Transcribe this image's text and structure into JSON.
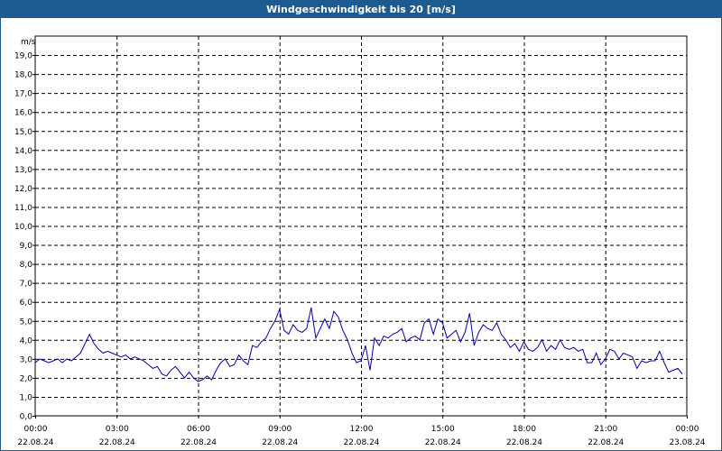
{
  "window": {
    "title": "Windgeschwindigkeit bis 20 [m/s]"
  },
  "colors": {
    "title_bar": "#1c5a8f",
    "series": "#0000a0",
    "grid": "#000000"
  },
  "chart_data": {
    "type": "line",
    "title": "Windgeschwindigkeit bis 20 [m/s]",
    "ylabel": "m/s",
    "ylim": [
      0,
      20
    ],
    "yticks": [
      "0,0",
      "1,0",
      "2,0",
      "3,0",
      "4,0",
      "5,0",
      "6,0",
      "7,0",
      "8,0",
      "9,0",
      "10,0",
      "11,0",
      "12,0",
      "13,0",
      "14,0",
      "15,0",
      "16,0",
      "17,0",
      "18,0",
      "19,0"
    ],
    "xlim": [
      "22.08.24 00:00",
      "23.08.24 00:00"
    ],
    "xticks": [
      {
        "time": "00:00",
        "date": "22.08.24"
      },
      {
        "time": "03:00",
        "date": "22.08.24"
      },
      {
        "time": "06:00",
        "date": "22.08.24"
      },
      {
        "time": "09:00",
        "date": "22.08.24"
      },
      {
        "time": "12:00",
        "date": "22.08.24"
      },
      {
        "time": "15:00",
        "date": "22.08.24"
      },
      {
        "time": "18:00",
        "date": "22.08.24"
      },
      {
        "time": "21:00",
        "date": "22.08.24"
      },
      {
        "time": "00:00",
        "date": "23.08.24"
      }
    ],
    "grid": true,
    "grid_style": "dashed",
    "series": [
      {
        "x": [
          "00:00",
          "00:10",
          "00:20",
          "00:30",
          "00:40",
          "00:50",
          "01:00",
          "01:10",
          "01:20",
          "01:30",
          "01:40",
          "01:50",
          "02:00",
          "02:10",
          "02:20",
          "02:30",
          "02:40",
          "02:50",
          "03:00",
          "03:10",
          "03:20",
          "03:30",
          "03:40",
          "03:50",
          "04:00",
          "04:10",
          "04:20",
          "04:30",
          "04:40",
          "04:50",
          "05:00",
          "05:10",
          "05:20",
          "05:30",
          "05:40",
          "05:50",
          "06:00",
          "06:10",
          "06:20",
          "06:30",
          "06:40",
          "06:50",
          "07:00",
          "07:10",
          "07:20",
          "07:30",
          "07:40",
          "07:50",
          "08:00",
          "08:10",
          "08:20",
          "08:30",
          "08:40",
          "08:50",
          "09:00",
          "09:10",
          "09:20",
          "09:30",
          "09:40",
          "09:50",
          "10:00",
          "10:10",
          "10:20",
          "10:30",
          "10:40",
          "10:50",
          "11:00",
          "11:10",
          "11:20",
          "11:30",
          "11:40",
          "11:50",
          "12:00",
          "12:10",
          "12:20",
          "12:30",
          "12:40",
          "12:50",
          "13:00",
          "13:10",
          "13:20",
          "13:30",
          "13:40",
          "13:50",
          "14:00",
          "14:10",
          "14:20",
          "14:30",
          "14:40",
          "14:50",
          "15:00",
          "15:10",
          "15:20",
          "15:30",
          "15:40",
          "15:50",
          "16:00",
          "16:10",
          "16:20",
          "16:30",
          "16:40",
          "16:50",
          "17:00",
          "17:10",
          "17:20",
          "17:30",
          "17:40",
          "17:50",
          "18:00",
          "18:10",
          "18:20",
          "18:30",
          "18:40",
          "18:50",
          "19:00",
          "19:10",
          "19:20",
          "19:30",
          "19:40",
          "19:50",
          "20:00",
          "20:10",
          "20:20",
          "20:30",
          "20:40",
          "20:50",
          "21:00",
          "21:10",
          "21:20",
          "21:30",
          "21:40",
          "21:50",
          "22:00",
          "22:10",
          "22:20",
          "22:30",
          "22:40",
          "22:50",
          "23:00",
          "23:10",
          "23:20",
          "23:30",
          "23:40",
          "23:50"
        ],
        "values": [
          2.8,
          3.0,
          2.9,
          2.8,
          2.9,
          3.0,
          2.8,
          3.0,
          2.9,
          3.1,
          3.3,
          3.8,
          4.3,
          3.8,
          3.5,
          3.3,
          3.4,
          3.3,
          3.2,
          3.1,
          3.2,
          3.0,
          3.1,
          3.0,
          2.9,
          2.7,
          2.5,
          2.6,
          2.2,
          2.1,
          2.4,
          2.6,
          2.3,
          2.0,
          2.3,
          2.0,
          1.8,
          1.9,
          2.1,
          1.9,
          2.4,
          2.8,
          3.0,
          2.6,
          2.7,
          3.2,
          2.9,
          2.7,
          3.7,
          3.6,
          3.9,
          4.1,
          4.6,
          5.0,
          5.6,
          4.5,
          4.3,
          4.8,
          4.5,
          4.4,
          4.6,
          5.7,
          4.1,
          4.6,
          5.1,
          4.6,
          5.5,
          5.2,
          4.5,
          4.0,
          3.3,
          2.8,
          2.9,
          3.7,
          2.4,
          4.1,
          3.7,
          4.2,
          4.1,
          4.3,
          4.4,
          4.6,
          3.9,
          4.1,
          4.2,
          4.0,
          4.9,
          5.1,
          4.3,
          5.1,
          4.9,
          4.1,
          4.3,
          4.5,
          3.9,
          4.4,
          5.4,
          3.7,
          4.4,
          4.8,
          4.6,
          4.5,
          4.9,
          4.3,
          4.0,
          3.6,
          3.8,
          3.4,
          3.9,
          3.5,
          3.4,
          3.6,
          4.0,
          3.4,
          3.7,
          3.5,
          4.0,
          3.6,
          3.5,
          3.6,
          3.4,
          3.5,
          2.8,
          2.8,
          3.3,
          2.7,
          3.0,
          3.5,
          3.4,
          3.0,
          3.3,
          3.2,
          3.1,
          2.5,
          2.9,
          2.8,
          2.9,
          2.9,
          3.4,
          2.8,
          2.3,
          2.4,
          2.5,
          2.2
        ]
      }
    ]
  }
}
